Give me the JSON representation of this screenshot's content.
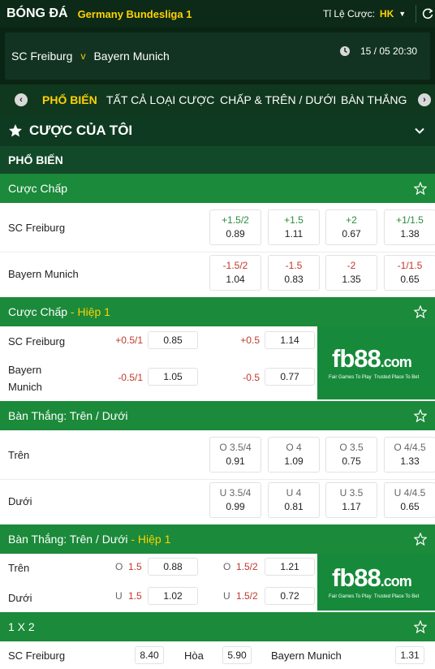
{
  "topbar": {
    "title": "BÓNG ĐÁ",
    "league": "Germany Bundesliga 1",
    "odds_label": "Tỉ Lệ Cược:",
    "odds_value": "HK"
  },
  "match": {
    "home": "SC Freiburg",
    "vs": "v",
    "away": "Bayern Munich",
    "datetime": "15 / 05  20:30"
  },
  "tabs": [
    {
      "label": "PHỔ BIẾN",
      "active": true
    },
    {
      "label": "TẤT CẢ LOẠI CƯỢC",
      "active": false
    },
    {
      "label": "CHẤP & TRÊN / DƯỚI",
      "active": false
    },
    {
      "label": "BÀN THẮNG",
      "active": false
    }
  ],
  "my_bets": "CƯỢC CỦA TÔI",
  "popular": "PHỔ BIẾN",
  "handicap": {
    "title": "Cược Chấp",
    "rows": [
      {
        "team": "SC Freiburg",
        "odds": [
          {
            "line": "+1.5/2",
            "price": "0.89"
          },
          {
            "line": "+1.5",
            "price": "1.11"
          },
          {
            "line": "+2",
            "price": "0.67"
          },
          {
            "line": "+1/1.5",
            "price": "1.38"
          }
        ]
      },
      {
        "team": "Bayern Munich",
        "odds": [
          {
            "line": "-1.5/2",
            "price": "1.04"
          },
          {
            "line": "-1.5",
            "price": "0.83"
          },
          {
            "line": "-2",
            "price": "1.35"
          },
          {
            "line": "-1/1.5",
            "price": "0.65"
          }
        ]
      }
    ]
  },
  "handicap_h1": {
    "title": "Cược Chấp",
    "sub": " - Hiệp 1",
    "rows": [
      {
        "team": "SC Freiburg",
        "odds": [
          {
            "line": "+0.5/1",
            "price": "0.85"
          },
          {
            "line": "+0.5",
            "price": "1.14"
          }
        ]
      },
      {
        "team": "Bayern Munich",
        "team_l1": "Bayern",
        "team_l2": "Munich",
        "odds": [
          {
            "line": "-0.5/1",
            "price": "1.05"
          },
          {
            "line": "-0.5",
            "price": "0.77"
          }
        ]
      }
    ]
  },
  "ou": {
    "title": "Bàn Thắng: Trên / Dưới",
    "rows": [
      {
        "label": "Trên",
        "odds": [
          {
            "line": "O 3.5/4",
            "price": "0.91"
          },
          {
            "line": "O 4",
            "price": "1.09"
          },
          {
            "line": "O 3.5",
            "price": "0.75"
          },
          {
            "line": "O 4/4.5",
            "price": "1.33"
          }
        ]
      },
      {
        "label": "Dưới",
        "odds": [
          {
            "line": "U 3.5/4",
            "price": "0.99"
          },
          {
            "line": "U 4",
            "price": "0.81"
          },
          {
            "line": "U 3.5",
            "price": "1.17"
          },
          {
            "line": "U 4/4.5",
            "price": "0.65"
          }
        ]
      }
    ]
  },
  "ou_h1": {
    "title": "Bàn Thắng: Trên / Dưới",
    "sub": " - Hiệp 1",
    "rows": [
      {
        "label": "Trên",
        "odds": [
          {
            "prefix": "O",
            "line": "1.5",
            "price": "0.88"
          },
          {
            "prefix": "O",
            "line": "1.5/2",
            "price": "1.21"
          }
        ]
      },
      {
        "label": "Dưới",
        "odds": [
          {
            "prefix": "U",
            "line": "1.5",
            "price": "1.02"
          },
          {
            "prefix": "U",
            "line": "1.5/2",
            "price": "0.72"
          }
        ]
      }
    ]
  },
  "x12": {
    "title": "1 X 2",
    "home": "SC Freiburg",
    "home_price": "8.40",
    "draw": "Hòa",
    "draw_price": "5.90",
    "away": "Bayern Munich",
    "away_price": "1.31"
  },
  "ad": {
    "brand": "fb88",
    "domain": ".com",
    "tag_a": "Fair Games To Play",
    "tag_b": "Trusted Place To Bet"
  },
  "colors": {
    "header_green": "#1b8a3a",
    "dark_green": "#0c2a17",
    "accent_yellow": "#ffd200",
    "positive_line": "#2a8c3e",
    "negative_line": "#c0392b"
  },
  "icons": [
    "refresh-icon",
    "clock-icon",
    "chevron-left-icon",
    "chevron-right-icon",
    "star-icon",
    "chevron-down-icon",
    "favorite-star-icon"
  ]
}
